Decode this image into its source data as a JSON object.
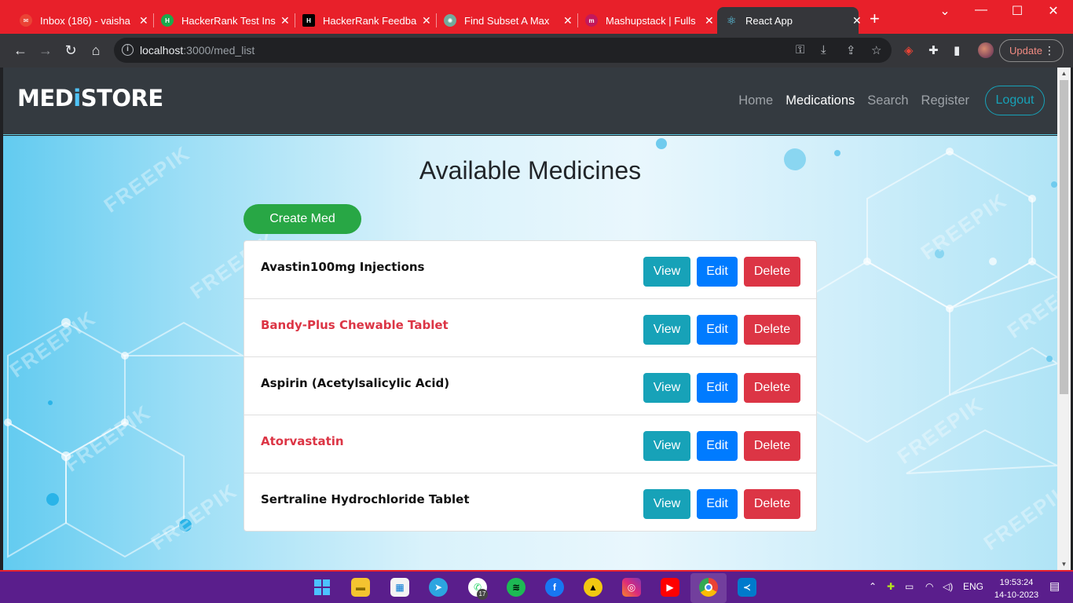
{
  "browser": {
    "tabs": [
      {
        "title": "Inbox (186) - vaisha",
        "icon": "gmail-icon",
        "color": "#ea4335"
      },
      {
        "title": "HackerRank Test Ins",
        "icon": "hackerrank-icon",
        "color": "#1ba94c"
      },
      {
        "title": "HackerRank Feedba",
        "icon": "hackerrank-icon",
        "color": "#000000"
      },
      {
        "title": "Find Subset A Max",
        "icon": "chatgpt-icon",
        "color": "#74aa9c"
      },
      {
        "title": "Mashupstack | Fulls",
        "icon": "mashupstack-icon",
        "color": "#c2185b"
      },
      {
        "title": "React App",
        "icon": "react-icon",
        "color": "#61dafb"
      }
    ],
    "url_host": "localhost",
    "url_path": ":3000/med_list",
    "update_label": "Update"
  },
  "app": {
    "brand": {
      "before": "MED",
      "i": "i",
      "after": "STORE"
    },
    "nav": {
      "home": "Home",
      "medications": "Medications",
      "search": "Search",
      "register": "Register",
      "logout": "Logout"
    },
    "page_title": "Available Medicines",
    "create_label": "Create Med",
    "actions": {
      "view": "View",
      "edit": "Edit",
      "delete": "Delete"
    },
    "watermark": "FREEPIK",
    "medicines": [
      {
        "name": "Avastin100mg Injections"
      },
      {
        "name": "Bandy-Plus Chewable Tablet"
      },
      {
        "name": "Aspirin (Acetylsalicylic Acid)"
      },
      {
        "name": "Atorvastatin"
      },
      {
        "name": "Sertraline Hydrochloride Tablet"
      }
    ]
  },
  "colors": {
    "accent_info": "#17a2b8",
    "accent_primary": "#007bff",
    "accent_danger": "#dc3545",
    "accent_success": "#28a745",
    "navbar_bg": "#343a40",
    "browser_frame": "#e8202a",
    "taskbar_bg": "#5a1e8c"
  },
  "taskbar": {
    "lang": "ENG",
    "time": "19:53:24",
    "date": "14-10-2023",
    "whatsapp_badge": "17"
  }
}
